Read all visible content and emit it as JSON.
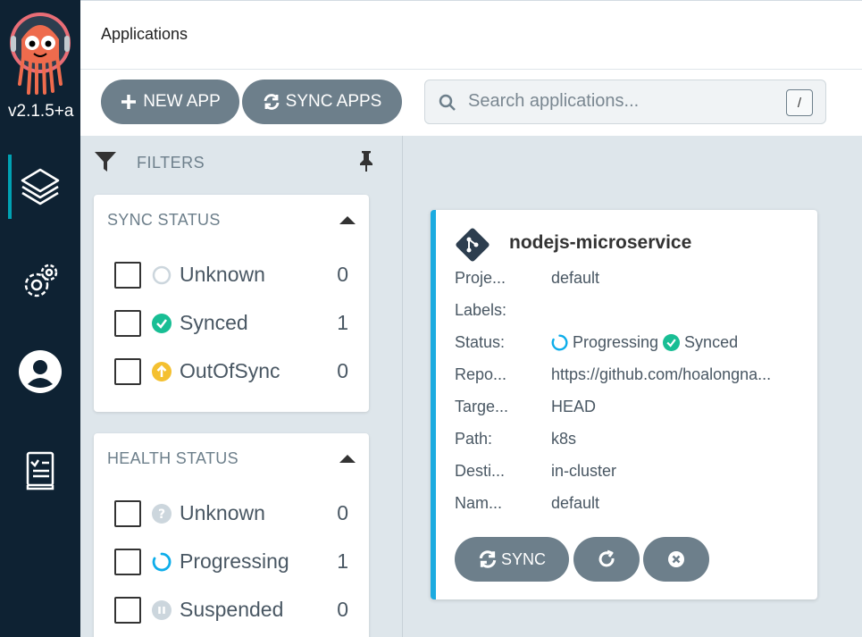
{
  "sidebar": {
    "version": "v2.1.5+a",
    "nav": [
      {
        "icon": "layers-icon"
      },
      {
        "icon": "gears-icon"
      },
      {
        "icon": "user-icon"
      },
      {
        "icon": "docs-icon"
      }
    ]
  },
  "header": {
    "title": "Applications",
    "new_app_label": "NEW APP",
    "sync_apps_label": "SYNC APPS",
    "search_placeholder": "Search applications...",
    "search_shortcut": "/"
  },
  "filters": {
    "label": "FILTERS",
    "sync_status": {
      "title": "SYNC STATUS",
      "items": [
        {
          "label": "Unknown",
          "count": "0",
          "icon": "circle-outline-icon"
        },
        {
          "label": "Synced",
          "count": "1",
          "icon": "check-circle-icon"
        },
        {
          "label": "OutOfSync",
          "count": "0",
          "icon": "arrow-up-circle-icon"
        }
      ]
    },
    "health_status": {
      "title": "HEALTH STATUS",
      "items": [
        {
          "label": "Unknown",
          "count": "0",
          "icon": "question-circle-icon"
        },
        {
          "label": "Progressing",
          "count": "1",
          "icon": "spinner-icon"
        },
        {
          "label": "Suspended",
          "count": "0",
          "icon": "pause-circle-icon"
        }
      ]
    }
  },
  "app": {
    "name": "nodejs-microservice",
    "fields": [
      {
        "key": "Proje...",
        "value": "default"
      },
      {
        "key": "Labels:",
        "value": ""
      },
      {
        "key": "Status:",
        "value": ""
      },
      {
        "key": "Repo...",
        "value": "https://github.com/hoalongna..."
      },
      {
        "key": "Targe...",
        "value": "HEAD"
      },
      {
        "key": "Path:",
        "value": "k8s"
      },
      {
        "key": "Desti...",
        "value": "in-cluster"
      },
      {
        "key": "Nam...",
        "value": "default"
      }
    ],
    "health_status": "Progressing",
    "sync_status": "Synced",
    "sync_button_label": "SYNC"
  },
  "colors": {
    "sidebar_bg": "#0e2233",
    "button_bg": "#6d7f8b",
    "synced_green": "#18be94",
    "progressing_blue": "#0dadea",
    "outofsync_yellow": "#f4c030",
    "unknown_gray": "#ccd6dd"
  }
}
